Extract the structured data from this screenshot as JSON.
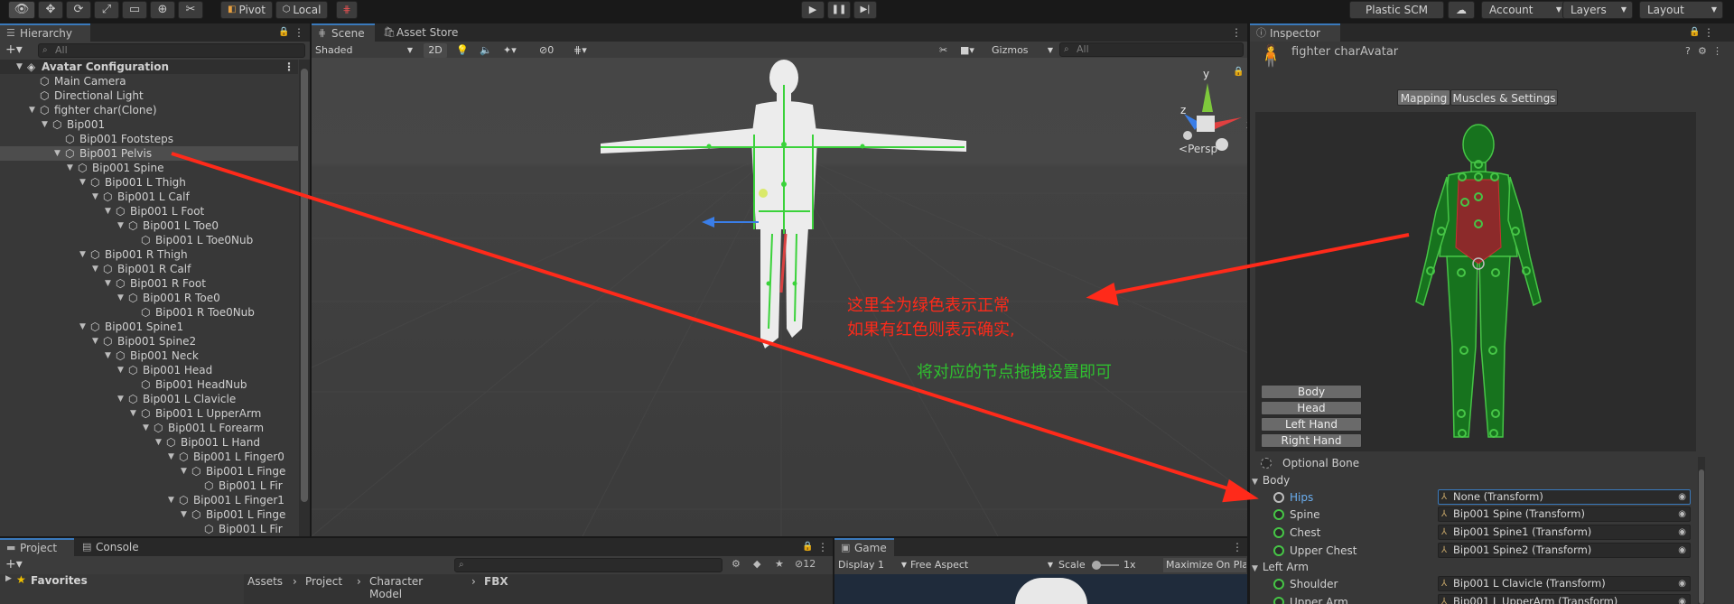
{
  "toolbar": {
    "pivot_label": "Pivot",
    "local_label": "Local",
    "plastic_label": "Plastic SCM",
    "account_label": "Account",
    "layers_label": "Layers",
    "layout_label": "Layout"
  },
  "hierarchy": {
    "tab": "Hierarchy",
    "search_placeholder": "All",
    "rows": [
      {
        "label": "Avatar Configuration",
        "depth": 0,
        "fold": "open",
        "root": true
      },
      {
        "label": "Main Camera",
        "depth": 1
      },
      {
        "label": "Directional Light",
        "depth": 1
      },
      {
        "label": "fighter char(Clone)",
        "depth": 1,
        "fold": "open"
      },
      {
        "label": "Bip001",
        "depth": 2,
        "fold": "open"
      },
      {
        "label": "Bip001 Footsteps",
        "depth": 3
      },
      {
        "label": "Bip001 Pelvis",
        "depth": 3,
        "fold": "open",
        "selected": true
      },
      {
        "label": "Bip001 Spine",
        "depth": 4,
        "fold": "open"
      },
      {
        "label": "Bip001 L Thigh",
        "depth": 5,
        "fold": "open"
      },
      {
        "label": "Bip001 L Calf",
        "depth": 6,
        "fold": "open"
      },
      {
        "label": "Bip001 L Foot",
        "depth": 7,
        "fold": "open"
      },
      {
        "label": "Bip001 L Toe0",
        "depth": 8,
        "fold": "open"
      },
      {
        "label": "Bip001 L Toe0Nub",
        "depth": 9
      },
      {
        "label": "Bip001 R Thigh",
        "depth": 5,
        "fold": "open"
      },
      {
        "label": "Bip001 R Calf",
        "depth": 6,
        "fold": "open"
      },
      {
        "label": "Bip001 R Foot",
        "depth": 7,
        "fold": "open"
      },
      {
        "label": "Bip001 R Toe0",
        "depth": 8,
        "fold": "open"
      },
      {
        "label": "Bip001 R Toe0Nub",
        "depth": 9
      },
      {
        "label": "Bip001 Spine1",
        "depth": 5,
        "fold": "open"
      },
      {
        "label": "Bip001 Spine2",
        "depth": 6,
        "fold": "open"
      },
      {
        "label": "Bip001 Neck",
        "depth": 7,
        "fold": "open"
      },
      {
        "label": "Bip001 Head",
        "depth": 8,
        "fold": "open"
      },
      {
        "label": "Bip001 HeadNub",
        "depth": 9
      },
      {
        "label": "Bip001 L Clavicle",
        "depth": 8,
        "fold": "open"
      },
      {
        "label": "Bip001 L UpperArm",
        "depth": 9,
        "fold": "open"
      },
      {
        "label": "Bip001 L Forearm",
        "depth": 10,
        "fold": "open"
      },
      {
        "label": "Bip001 L Hand",
        "depth": 11,
        "fold": "open"
      },
      {
        "label": "Bip001 L Finger0",
        "depth": 12,
        "fold": "open"
      },
      {
        "label": "Bip001 L Finge",
        "depth": 13,
        "fold": "open"
      },
      {
        "label": "Bip001 L Fir",
        "depth": 14
      },
      {
        "label": "Bip001 L Finger1",
        "depth": 12,
        "fold": "open"
      },
      {
        "label": "Bip001 L Finge",
        "depth": 13,
        "fold": "open"
      },
      {
        "label": "Bip001 L Fir",
        "depth": 14
      }
    ]
  },
  "scene": {
    "tab": "Scene",
    "store_tab": "Asset Store",
    "shading": "Shaded",
    "mode_2d": "2D",
    "hidden_count": "0",
    "gizmos": "Gizmos",
    "search_placeholder": "All",
    "persp": "Persp",
    "axis_y": "y",
    "axis_x": "x",
    "axis_z": "z"
  },
  "annotations": {
    "line1": "这里全为绿色表示正常",
    "line2": "如果有红色则表示确实,",
    "line3": "将对应的节点拖拽设置即可",
    "red": "#ff2a1a",
    "green": "#2fbf2f"
  },
  "inspector": {
    "tab": "Inspector",
    "object_name": "fighter charAvatar",
    "mapping_tab": "Mapping",
    "muscles_tab": "Muscles & Settings",
    "body_buttons": [
      "Body",
      "Head",
      "Left Hand",
      "Right Hand"
    ],
    "optional_bone": "Optional Bone",
    "body_section": "Body",
    "left_arm_section": "Left Arm",
    "bones": [
      {
        "name": "Hips",
        "value": "None (Transform)",
        "state": "empty"
      },
      {
        "name": "Spine",
        "value": "Bip001 Spine (Transform)",
        "state": "ok"
      },
      {
        "name": "Chest",
        "value": "Bip001 Spine1 (Transform)",
        "state": "ok"
      },
      {
        "name": "Upper Chest",
        "value": "Bip001 Spine2 (Transform)",
        "state": "ok"
      },
      {
        "name": "Shoulder",
        "value": "Bip001 L Clavicle (Transform)",
        "state": "ok"
      },
      {
        "name": "Upper Arm",
        "value": "Bip001 L UpperArm (Transform)",
        "state": "ok"
      }
    ],
    "accent_ok": "#46c546",
    "accent_missing": "#c83232"
  },
  "project": {
    "tab": "Project",
    "console_tab": "Console",
    "favorites": "Favorites",
    "hidden_count": "12",
    "breadcrumb": [
      "Assets",
      "Project",
      "Character Model",
      "FBX"
    ]
  },
  "game": {
    "tab": "Game",
    "display": "Display 1",
    "aspect": "Free Aspect",
    "scale_label": "Scale",
    "scale_value": "1x",
    "maximize": "Maximize On Pla"
  }
}
